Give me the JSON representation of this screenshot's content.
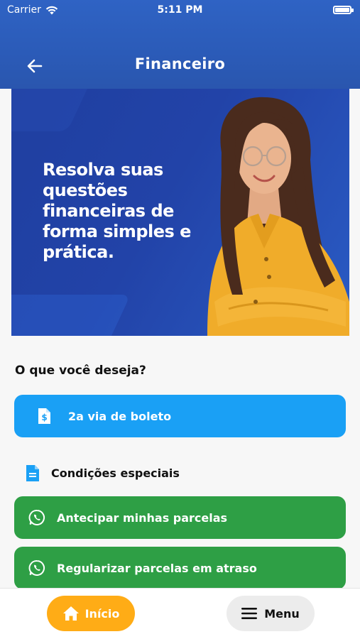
{
  "status_bar": {
    "carrier": "Carrier",
    "time": "5:11 PM"
  },
  "header": {
    "title": "Financeiro",
    "back_icon": "arrow-left-icon"
  },
  "banner": {
    "headline": "Resolva suas questões financeiras de forma simples e prática.",
    "background_color": "#2243a8"
  },
  "main": {
    "question": "O que você deseja?",
    "primary_action": {
      "label": "2a via de boleto",
      "icon": "invoice-dollar-icon",
      "color": "#1aa0f5"
    },
    "special_section": {
      "label": "Condições especiais",
      "icon": "document-icon"
    },
    "actions": [
      {
        "label": "Antecipar minhas parcelas",
        "icon": "whatsapp-icon",
        "color": "#2e9f45"
      },
      {
        "label": "Regularizar parcelas em atraso",
        "icon": "whatsapp-icon",
        "color": "#2e9f45"
      }
    ]
  },
  "bottom_nav": {
    "home_label": "Início",
    "home_icon": "home-icon",
    "home_color": "#ffac16",
    "menu_label": "Menu",
    "menu_icon": "hamburger-icon"
  }
}
